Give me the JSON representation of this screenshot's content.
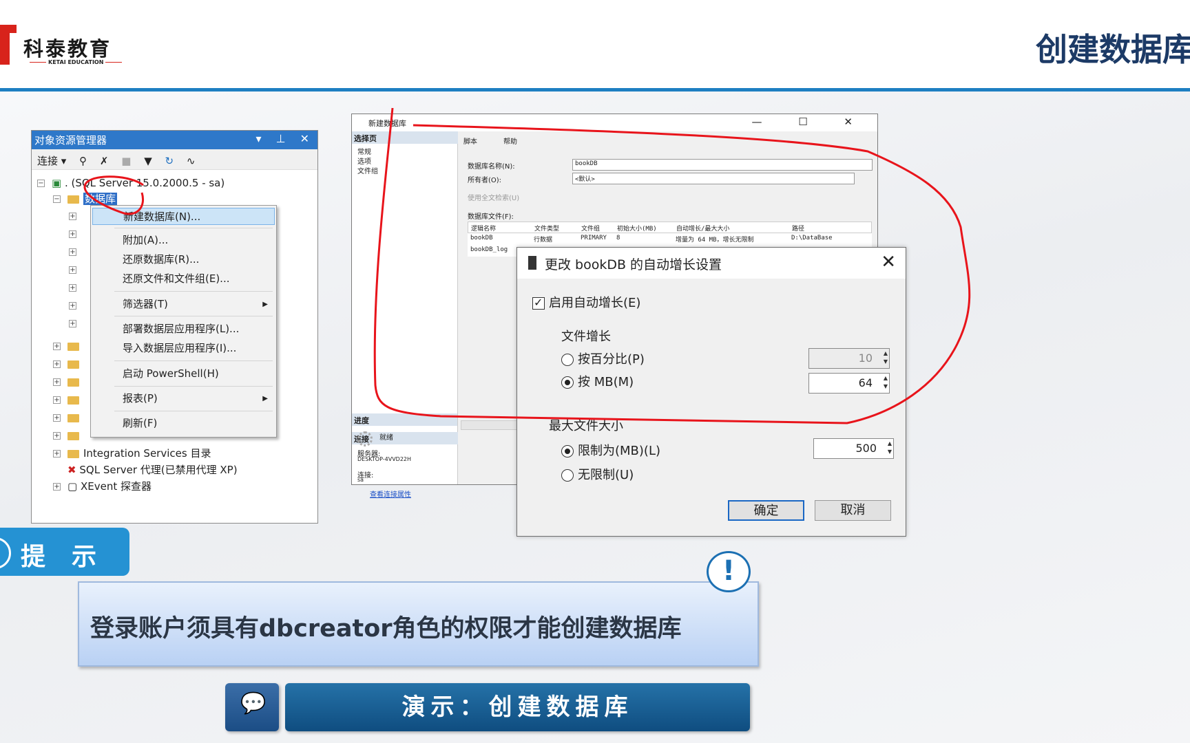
{
  "brand": {
    "name": "科泰教育",
    "sub": "KETAI EDUCATION"
  },
  "page_title": "创建数据库",
  "object_explorer": {
    "title": "对象资源管理器",
    "title_controls": "▾ ⊥ ✕",
    "toolbar": {
      "connect": "连接 ▾"
    },
    "server_node": ". (SQL Server 15.0.2000.5 - sa)",
    "databases_node": "数据库",
    "integration_services": "Integration Services 目录",
    "sql_agent": "SQL Server 代理(已禁用代理 XP)",
    "xevent": "XEvent 探查器"
  },
  "context_menu": {
    "items": [
      {
        "label": "新建数据库(N)..."
      },
      {
        "label": "附加(A)..."
      },
      {
        "label": "还原数据库(R)..."
      },
      {
        "label": "还原文件和文件组(E)..."
      },
      {
        "label": "筛选器(T)"
      },
      {
        "label": "部署数据层应用程序(L)..."
      },
      {
        "label": "导入数据层应用程序(I)..."
      },
      {
        "label": "启动 PowerShell(H)"
      },
      {
        "label": "报表(P)"
      },
      {
        "label": "刷新(F)"
      }
    ]
  },
  "new_db_window": {
    "title": "新建数据库",
    "controls": "— ☐ ✕",
    "select_page": "选择页",
    "pages": [
      "常规",
      "选项",
      "文件组"
    ],
    "toolbar_script": "脚本",
    "toolbar_help": "帮助",
    "db_name_label": "数据库名称(N):",
    "db_name_value": "bookDB",
    "owner_label": "所有者(O):",
    "owner_value": "<默认>",
    "fulltext_label": "使用全文检索(U)",
    "files_label": "数据库文件(F):",
    "grid_headers": [
      "逻辑名称",
      "文件类型",
      "文件组",
      "初始大小(MB)",
      "自动增长/最大大小",
      "路径"
    ],
    "grid_rows": [
      [
        "bookDB",
        "行数据",
        "PRIMARY",
        "8",
        "增量为 64 MB，增长无限制",
        "D:\\DataBase"
      ],
      [
        "bookDB_log",
        "",
        "",
        "",
        "",
        ""
      ]
    ],
    "connection_head": "连接",
    "server_label": "服务器:",
    "server_value": "DESKTOP-4VVD22H",
    "conn_label": "连接:",
    "conn_value": "sa",
    "conn_link": "查看连接属性",
    "progress_head": "进度",
    "progress_status": "就绪"
  },
  "autogrowth_dialog": {
    "title": "更改 bookDB 的自动增长设置",
    "enable_label": "启用自动增长(E)",
    "file_growth_label": "文件增长",
    "by_percent_label": "按百分比(P)",
    "by_percent_value": "10",
    "by_mb_label": "按 MB(M)",
    "by_mb_value": "64",
    "max_size_label": "最大文件大小",
    "limited_label": "限制为(MB)(L)",
    "limited_value": "500",
    "unlimited_label": "无限制(U)",
    "ok_label": "确定",
    "cancel_label": "取消"
  },
  "tip": {
    "tab_label": "提示",
    "text": "登录账户须具有dbcreator角色的权限才能创建数据库",
    "exclaim": "!"
  },
  "demo": {
    "label": "演示：创建数据库"
  },
  "colors": {
    "accent": "#1e7fc2",
    "title": "#1c3a66",
    "annotation": "#e8141b"
  }
}
